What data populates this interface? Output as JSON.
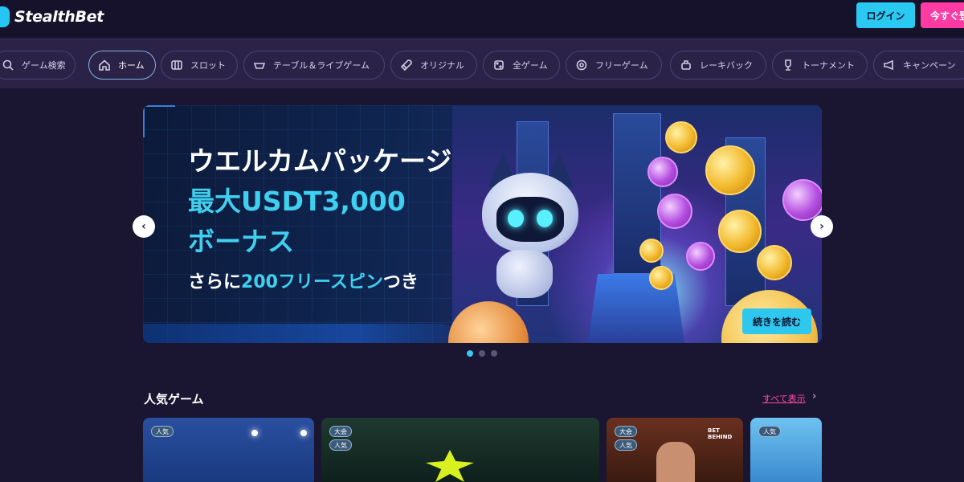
{
  "header": {
    "logo_text": "StealthBet",
    "login_label": "ログイン",
    "register_label": "今すぐ登録"
  },
  "nav": {
    "items": [
      {
        "label": "ゲーム検索",
        "icon": "search-icon"
      },
      {
        "label": "ホーム",
        "icon": "home-icon",
        "active": true
      },
      {
        "label": "スロット",
        "icon": "slot-icon"
      },
      {
        "label": "テーブル＆ライブゲーム",
        "icon": "table-icon"
      },
      {
        "label": "オリジナル",
        "icon": "rocket-icon"
      },
      {
        "label": "全ゲーム",
        "icon": "dice-icon"
      },
      {
        "label": "フリーゲーム",
        "icon": "free-game-icon"
      },
      {
        "label": "レーキバック",
        "icon": "rakeback-icon"
      },
      {
        "label": "トーナメント",
        "icon": "trophy-icon"
      },
      {
        "label": "キャンペーン",
        "icon": "megaphone-icon"
      }
    ]
  },
  "banner": {
    "line1": "ウエルカムパッケージ",
    "line2": "最大USDT3,000",
    "line3": "ボーナス",
    "line4_prefix": "さらに",
    "line4_highlight": "200フリースピン",
    "line4_suffix": "つき",
    "read_more_label": "続きを読む",
    "slide_count": 3,
    "active_slide": 1
  },
  "popular": {
    "title": "人気ゲーム",
    "see_all_label": "すべて表示",
    "cards": [
      {
        "badges": [
          "人気"
        ],
        "bg": "#1a3f8a"
      },
      {
        "badges": [
          "大会",
          "人気"
        ],
        "bg": "#1d2f2a"
      },
      {
        "badges": [
          "大会",
          "人気"
        ],
        "bg": "#5a2a1a",
        "label": "BET BEHIND"
      },
      {
        "badges": [
          "人気"
        ],
        "bg": "#5fb8e8"
      }
    ]
  },
  "colors": {
    "accent_cyan": "#29c9f1",
    "accent_pink": "#ff3aa3",
    "background": "#1a1530",
    "nav_background": "#2a2347"
  }
}
